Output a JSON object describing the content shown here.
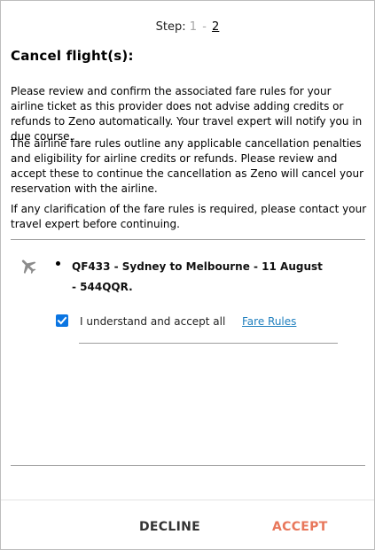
{
  "stepper": {
    "prefix": "Step:",
    "current": "1",
    "separator": "-",
    "next": "2"
  },
  "dialog": {
    "title": "Cancel flight(s):",
    "paragraphs": [
      "Please review and confirm the associated fare rules for your airline ticket as this provider does not advise adding credits or refunds to Zeno automatically. Your travel expert will notify you in due course.",
      "The airline fare rules outline any applicable cancellation penalties and eligibility for airline credits or refunds. Please review and accept these to continue the cancellation as Zeno will cancel your reservation with the airline.",
      "If any clarification of the fare rules is required, please contact your travel expert before continuing."
    ]
  },
  "flight": {
    "icon": "plane-icon",
    "description": "QF433 - Sydney to Melbourne - 11 August - 544QQR.",
    "accept_checked": true,
    "accept_label": "I understand and accept all",
    "fare_rules_link": "Fare Rules"
  },
  "footer": {
    "decline_label": "DECLINE",
    "accept_label": "ACCEPT"
  },
  "colors": {
    "accent": "#e8775b",
    "checkbox": "#0a75e2",
    "link": "#1f7fbe"
  }
}
